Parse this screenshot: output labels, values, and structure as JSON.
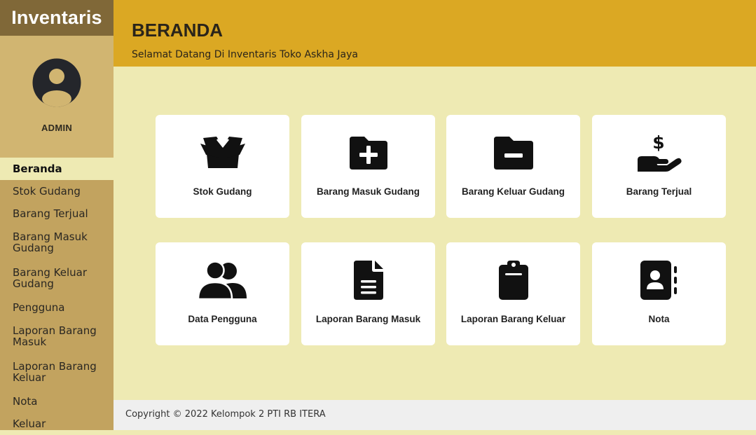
{
  "sidebar": {
    "brand": "Inventaris",
    "role": "ADMIN",
    "items": [
      {
        "label": "Beranda"
      },
      {
        "label": "Stok Gudang"
      },
      {
        "label": "Barang Terjual"
      },
      {
        "label": "Barang Masuk Gudang"
      },
      {
        "label": "Barang Keluar Gudang"
      },
      {
        "label": "Pengguna"
      },
      {
        "label": "Laporan Barang Masuk"
      },
      {
        "label": "Laporan Barang Keluar"
      },
      {
        "label": "Nota"
      },
      {
        "label": "Keluar"
      }
    ]
  },
  "header": {
    "title": "BERANDA",
    "subtitle": "Selamat Datang Di Inventaris Toko Askha Jaya"
  },
  "cards": [
    {
      "label": "Stok Gudang",
      "icon": "box-open-icon"
    },
    {
      "label": "Barang Masuk Gudang",
      "icon": "folder-plus-icon"
    },
    {
      "label": "Barang Keluar Gudang",
      "icon": "folder-minus-icon"
    },
    {
      "label": "Barang Terjual",
      "icon": "hand-holding-dollar-icon"
    },
    {
      "label": "Data Pengguna",
      "icon": "users-icon"
    },
    {
      "label": "Laporan Barang Masuk",
      "icon": "file-lines-icon"
    },
    {
      "label": "Laporan Barang Keluar",
      "icon": "clipboard-icon"
    },
    {
      "label": "Nota",
      "icon": "address-book-icon"
    }
  ],
  "footer": {
    "copyright": "Copyright © 2022 Kelompok 2 PTI RB ITERA"
  },
  "colors": {
    "sidebar": "#c2a35f",
    "brand_bar": "#806838",
    "header": "#dba823",
    "content_bg": "#eeeab3",
    "card": "#ffffff",
    "footer": "#efefef"
  }
}
